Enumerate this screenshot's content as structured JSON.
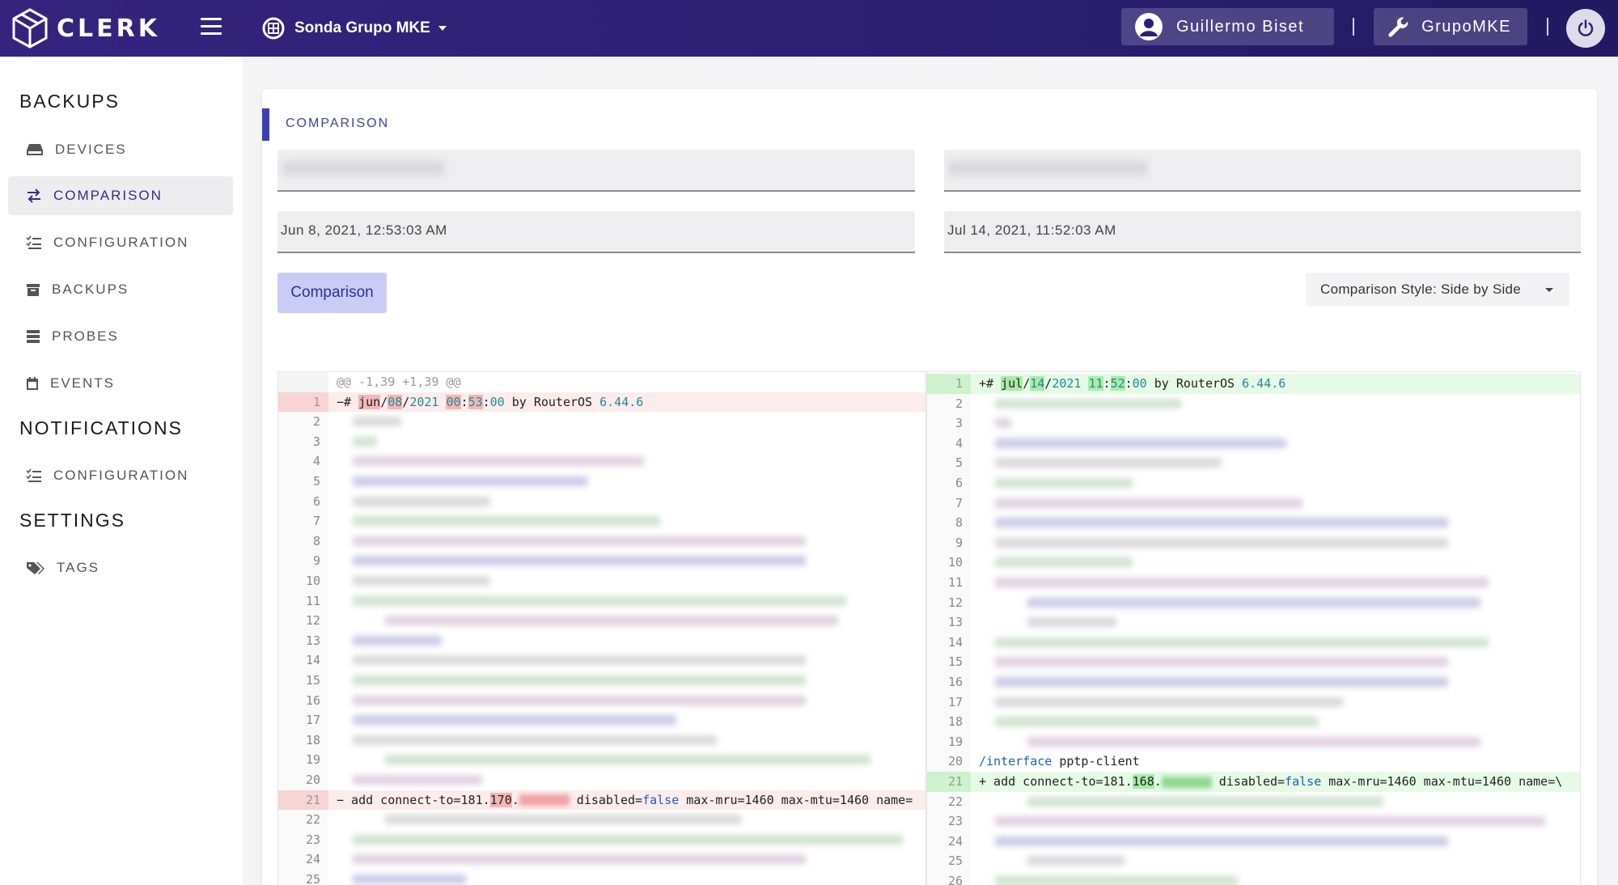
{
  "topbar": {
    "brand": "CLERK",
    "org_name": "Sonda Grupo MKE",
    "user_name": "Guillermo Biset",
    "tool_label": "GrupoMKE"
  },
  "sidebar": {
    "sections": [
      {
        "title": "BACKUPS",
        "items": [
          "DEVICES",
          "COMPARISON",
          "CONFIGURATION",
          "BACKUPS",
          "PROBES",
          "EVENTS"
        ]
      },
      {
        "title": "NOTIFICATIONS",
        "items": [
          "CONFIGURATION"
        ]
      },
      {
        "title": "SETTINGS",
        "items": [
          "TAGS"
        ]
      }
    ],
    "active_item": "COMPARISON"
  },
  "comparison": {
    "title": "COMPARISON",
    "left_date": "Jun 8, 2021, 12:53:03 AM",
    "right_date": "Jul 14, 2021, 11:52:03 AM",
    "button_label": "Comparison",
    "style_label": "Comparison Style: Side by Side"
  },
  "diff": {
    "hunk_header": "@@ -1,39 +1,39 @@",
    "left_line1": {
      "sign": "−",
      "hash": "# ",
      "month": "jun",
      "s1": "/",
      "day": "08",
      "s2": "/",
      "year": "2021",
      "sp": " ",
      "hh": "00",
      "c1": ":",
      "mm": "53",
      "c2": ":",
      "ss": "00",
      "by": " by RouterOS ",
      "ver": "6.44.6"
    },
    "right_line1": {
      "sign": "+",
      "hash": "# ",
      "month": "jul",
      "s1": "/",
      "day": "14",
      "s2": "/",
      "year": "2021",
      "sp": " ",
      "hh": "11",
      "c1": ":",
      "mm": "52",
      "c2": ":",
      "ss": "00",
      "by": " by RouterOS ",
      "ver": "6.44.6"
    },
    "right_line20": {
      "kw": "/interface",
      "rest": " pptp-client"
    },
    "left_line21": {
      "sign": "−",
      "pre": " add connect-to=181.",
      "hl": "170",
      "rest1": ".",
      "f": "false",
      "eq": " disabled=",
      "tail": " max-mru=1460 max-mtu=1460 name="
    },
    "right_line21": {
      "sign": "+",
      "pre": " add connect-to=181.",
      "hl": "168",
      "rest1": ".",
      "f": "false",
      "eq": " disabled=",
      "tail": " max-mru=1460 max-mtu=1460 name=\\"
    },
    "left_line_numbers": [
      "1",
      "2",
      "3",
      "4",
      "5",
      "6",
      "7",
      "8",
      "9",
      "10",
      "11",
      "12",
      "13",
      "14",
      "15",
      "16",
      "17",
      "18",
      "19",
      "20",
      "21",
      "22",
      "23",
      "24",
      "25"
    ],
    "right_line_numbers": [
      "1",
      "2",
      "3",
      "4",
      "5",
      "6",
      "7",
      "8",
      "9",
      "10",
      "11",
      "12",
      "13",
      "14",
      "15",
      "16",
      "17",
      "18",
      "19",
      "20",
      "21",
      "22",
      "23",
      "24",
      "25",
      "26"
    ]
  }
}
